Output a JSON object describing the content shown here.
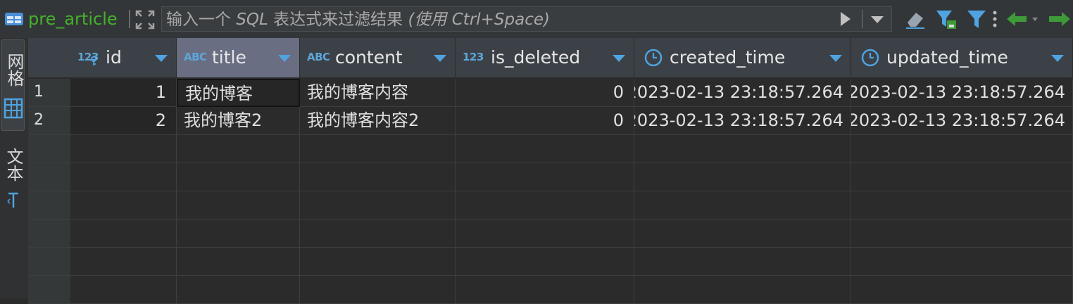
{
  "toolbar": {
    "table_name": "pre_article",
    "filter_placeholder_pre": "输入一个",
    "filter_placeholder_sql": " SQL ",
    "filter_placeholder_mid": "表达式来过滤结果",
    "filter_placeholder_hint": " (使用 Ctrl+Space)",
    "icons": [
      "table-icon",
      "expand-icon",
      "play-icon",
      "dropdown-icon",
      "eraser-icon",
      "filter-save-icon",
      "filter-icon",
      "more-icon",
      "back-arrow-icon",
      "forward-arrow-icon"
    ]
  },
  "sidebar": {
    "tabs": [
      {
        "label": "网格",
        "icon": "grid-icon",
        "active": true
      },
      {
        "label": "文本",
        "icon": "text-icon",
        "active": false
      }
    ]
  },
  "columns": [
    {
      "type": "123",
      "name": "id",
      "key": true
    },
    {
      "type": "ABC",
      "name": "title"
    },
    {
      "type": "ABC",
      "name": "content"
    },
    {
      "type": "123",
      "name": "is_deleted"
    },
    {
      "type": "clock",
      "name": "created_time"
    },
    {
      "type": "clock",
      "name": "updated_time"
    }
  ],
  "rows": [
    {
      "num": "1",
      "id": "1",
      "title": "我的博客",
      "content": "我的博客内容",
      "is_deleted": "0",
      "created_time": "2023-02-13 23:18:57.264",
      "updated_time": "2023-02-13 23:18:57.264"
    },
    {
      "num": "2",
      "id": "2",
      "title": "我的博客2",
      "content": "我的博客内容2",
      "is_deleted": "0",
      "created_time": "2023-02-13 23:18:57.264",
      "updated_time": "2023-02-13 23:18:57.264"
    }
  ],
  "colors": {
    "table_name": "#44b22a",
    "accent": "#4fa3e0",
    "selected_header": "#6a6e83",
    "nav_arrows": "#3e9a38"
  }
}
